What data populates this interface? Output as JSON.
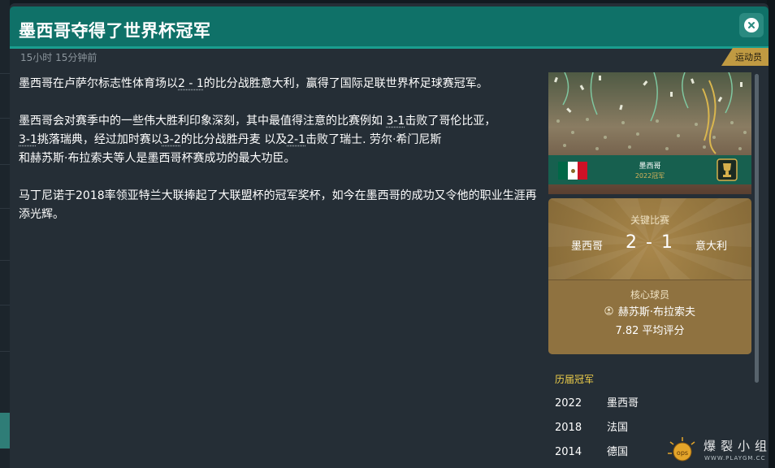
{
  "dialog": {
    "title": "墨西哥夺得了世界杯冠军",
    "timestamp": "15小时 15分钟前",
    "tag": "运动员"
  },
  "body": {
    "p1": {
      "a": "墨西哥在卢萨尔标志性体育场以",
      "score": "2 - 1",
      "b": "的比分战胜意大利，赢得了国际足联世界杯足球赛冠军。"
    },
    "p2": {
      "a": "墨西哥会对赛季中的一些伟大胜利印象深刻，其中最值得注意的比赛例如 ",
      "s1": "3-1",
      "b": "击败了哥伦比亚，",
      "s2": "3-1",
      "c": "挑落瑞典，经过加时赛以",
      "s3": "3-2",
      "d": "的比分战胜丹麦 以及",
      "s4": "2-1",
      "e": "击败了瑞士. 劳尔·希门尼斯",
      "f": "和赫苏斯·布拉索夫等人是墨西哥杯赛成功的最大功臣。"
    },
    "p3": "马丁尼诺于2018率领亚特兰大联捧起了大联盟杯的冠军奖杯，如今在墨西哥的成功又令他的职业生涯再添光辉。"
  },
  "hero": {
    "team": "墨西哥",
    "year_title": "2022冠军"
  },
  "match_card": {
    "key_match_label": "关键比赛",
    "home": "墨西哥",
    "score": "2 - 1",
    "away": "意大利",
    "key_player_label": "核心球员",
    "player": "赫苏斯·布拉索夫",
    "rating": "7.82 平均评分"
  },
  "history": {
    "title": "历届冠军",
    "rows": [
      {
        "year": "2022",
        "team": "墨西哥"
      },
      {
        "year": "2018",
        "team": "法国"
      },
      {
        "year": "2014",
        "team": "德国"
      }
    ]
  },
  "watermark": {
    "text": "爆裂小组",
    "sub": "WWW.PLAYGM.CC",
    "badge": "ops"
  },
  "colors": {
    "header": "#0f7168",
    "accent_teal": "#1a9e8f",
    "card_gold": "#94763f",
    "history_title": "#f0d04a",
    "mexico_green": "#006847",
    "mexico_red": "#ce1126"
  }
}
